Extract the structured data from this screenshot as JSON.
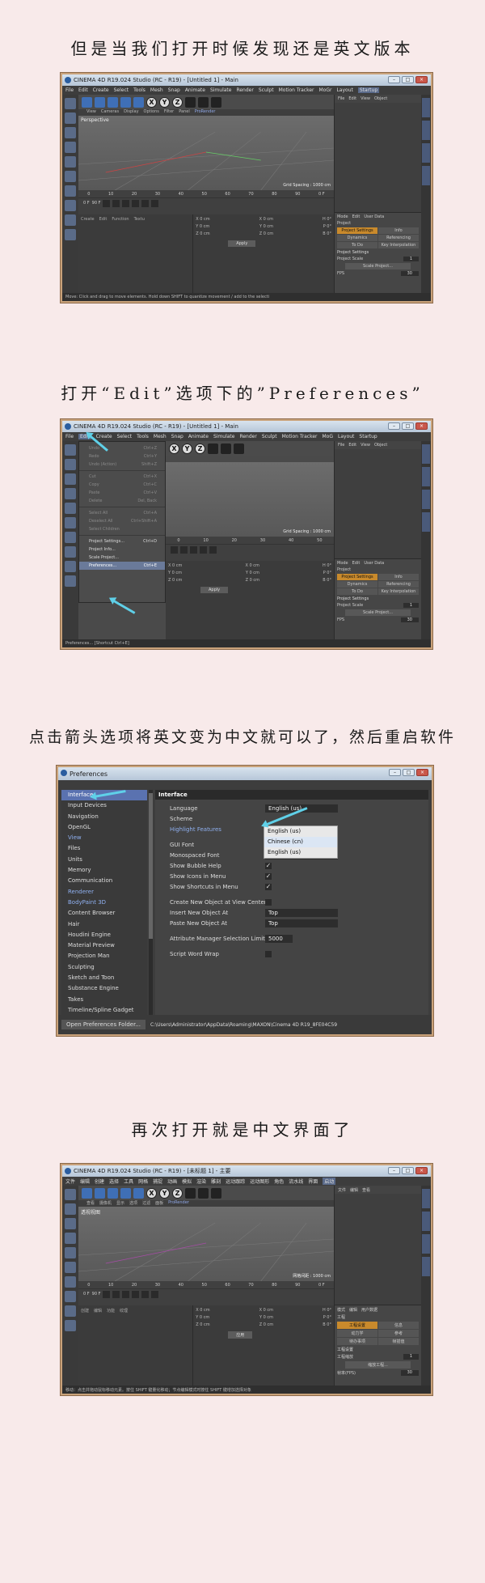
{
  "captions": {
    "c1": "但是当我们打开时候发现还是英文版本",
    "c2": "打开“Edit”选项下的”Preferences”",
    "c3": "点击箭头选项将英文变为中文就可以了，然后重启软件",
    "c4": "再次打开就是中文界面了"
  },
  "shot1": {
    "title": "CINEMA 4D R19.024 Studio (RC - R19) - [Untitled 1] - Main",
    "menu": [
      "File",
      "Edit",
      "Create",
      "Select",
      "Tools",
      "Mesh",
      "Snap",
      "Animate",
      "Simulate",
      "Render",
      "Sculpt",
      "Motion Tracker",
      "MoGr",
      "Layout",
      "Startup"
    ],
    "vptabs": [
      "View",
      "Cameras",
      "Display",
      "Options",
      "Filter",
      "Panel",
      "ProRender"
    ],
    "viewport_label": "Perspective",
    "grid_spacing": "Grid Spacing : 1000 cm",
    "ruler": [
      "0",
      "10",
      "20",
      "30",
      "40",
      "50",
      "60",
      "70",
      "80",
      "90",
      "0 F"
    ],
    "frame_start": "0 F",
    "frame_end": "90 F",
    "mat_menu": [
      "Create",
      "Edit",
      "Function",
      "Textu"
    ],
    "coords": [
      [
        "X 0 cm",
        "X 0 cm",
        "H 0°"
      ],
      [
        "Y 0 cm",
        "Y 0 cm",
        "P 0°"
      ],
      [
        "Z 0 cm",
        "Z 0 cm",
        "B 0°"
      ]
    ],
    "apply": "Apply",
    "om_menu": [
      "File",
      "Edit",
      "View",
      "Object"
    ],
    "attr_menu": [
      "Mode",
      "Edit",
      "User Data"
    ],
    "attr_obj": "Project",
    "tabs": [
      "Project Settings",
      "Info",
      "Dynamics",
      "Referencing",
      "To Do",
      "Key Interpolation"
    ],
    "section": "Project Settings",
    "field1_label": "Project Scale",
    "field1_val": "1",
    "scale_btn": "Scale Project...",
    "field2_label": "FPS",
    "field2_val": "30",
    "status": "Move: Click and drag to move elements. Hold down SHIFT to quantize movement / add to the selecti"
  },
  "shot2": {
    "title": "CINEMA 4D R19.024 Studio (RC - R19) - [Untitled 1] - Main",
    "menu": [
      "File",
      "Edit",
      "Create",
      "Select",
      "Tools",
      "Mesh",
      "Snap",
      "Animate",
      "Simulate",
      "Render",
      "Sculpt",
      "Motion Tracker",
      "MoG",
      "Layout",
      "Startup"
    ],
    "editmenu": [
      {
        "label": "Undo",
        "key": "Ctrl+Z"
      },
      {
        "label": "Redo",
        "key": "Ctrl+Y"
      },
      {
        "label": "Undo (Action)",
        "key": "Shift+Z"
      },
      {
        "label": "Cut",
        "key": "Ctrl+X"
      },
      {
        "label": "Copy",
        "key": "Ctrl+C"
      },
      {
        "label": "Paste",
        "key": "Ctrl+V"
      },
      {
        "label": "Delete",
        "key": "Del, Back"
      },
      {
        "label": "Select All",
        "key": "Ctrl+A"
      },
      {
        "label": "Deselect All",
        "key": "Ctrl+Shift+A"
      },
      {
        "label": "Select Children",
        "key": ""
      },
      {
        "label": "Project Settings...",
        "key": "Ctrl+D"
      },
      {
        "label": "Project Info...",
        "key": ""
      },
      {
        "label": "Scale Project...",
        "key": ""
      },
      {
        "label": "Preferences...",
        "key": "Ctrl+E"
      }
    ],
    "status": "Preferences... [Shortcut Ctrl+E]"
  },
  "prefs": {
    "title": "Preferences",
    "categories": [
      "Interface",
      "Input Devices",
      "Navigation",
      "OpenGL",
      "View",
      "Files",
      "Units",
      "Memory",
      "Communication",
      "Renderer",
      "BodyPaint 3D",
      "Content Browser",
      "Hair",
      "Houdini Engine",
      "Material Preview",
      "Projection Man",
      "Sculpting",
      "Sketch and Toon",
      "Substance Engine",
      "Takes",
      "Timeline/Spline Gadget",
      "Import/Export"
    ],
    "panel_head": "Interface",
    "rows": [
      {
        "label": "Language",
        "value": "English (us)"
      },
      {
        "label": "Scheme",
        "value": ""
      },
      {
        "label": "Highlight Features",
        "value": ""
      },
      {
        "label": "GUI Font",
        "value": "微软雅黑"
      },
      {
        "label": "Monospaced Font",
        "value": "Courier New"
      },
      {
        "label": "Show Bubble Help",
        "value": "✓"
      },
      {
        "label": "Show Icons in Menu",
        "value": "✓"
      },
      {
        "label": "Show Shortcuts in Menu",
        "value": "✓"
      },
      {
        "label": "Create New Object at View Center",
        "value": ""
      },
      {
        "label": "Insert New Object At",
        "value": "Top"
      },
      {
        "label": "Paste New Object At",
        "value": "Top"
      },
      {
        "label": "Attribute Manager Selection Limit",
        "value": "5000"
      },
      {
        "label": "Script Word Wrap",
        "value": ""
      }
    ],
    "lang_options": [
      "English (us)",
      "Chinese (cn)",
      "English (us)"
    ],
    "open_btn": "Open Preferences Folder...",
    "path": "C:\\Users\\Administrator\\AppData\\Roaming\\MAXON\\Cinema 4D R19_8FE04C59"
  },
  "shot4": {
    "title": "CINEMA 4D R19.024 Studio (RC - R19) - [未标题 1] - 主要",
    "menu": [
      "文件",
      "编辑",
      "创建",
      "选择",
      "工具",
      "网格",
      "捕捉",
      "动画",
      "模拟",
      "渲染",
      "雕刻",
      "运动跟踪",
      "运动图形",
      "角色",
      "流水线",
      "界面",
      "启动"
    ],
    "vptabs": [
      "查看",
      "摄像机",
      "显示",
      "选项",
      "过滤",
      "面板",
      "ProRender"
    ],
    "viewport_label": "透视视图",
    "grid_spacing": "网格间距 : 1000 cm",
    "ruler": [
      "0",
      "10",
      "20",
      "30",
      "40",
      "50",
      "60",
      "70",
      "80",
      "90",
      "0 F"
    ],
    "frame_start": "0 F",
    "frame_end": "90 F",
    "mat_menu": [
      "创建",
      "编辑",
      "功能",
      "纹理"
    ],
    "coords": [
      [
        "X 0 cm",
        "X 0 cm",
        "H 0°"
      ],
      [
        "Y 0 cm",
        "Y 0 cm",
        "P 0°"
      ],
      [
        "Z 0 cm",
        "Z 0 cm",
        "B 0°"
      ]
    ],
    "apply": "应用",
    "om_menu": [
      "文件",
      "编辑",
      "查看"
    ],
    "attr_menu": [
      "模式",
      "编辑",
      "用户数据"
    ],
    "attr_obj": "工程",
    "tabs": [
      "工程设置",
      "信息",
      "动力学",
      "参考",
      "待办事项",
      "帧插值"
    ],
    "section": "工程设置",
    "field1_label": "工程缩放",
    "field1_val": "1",
    "scale_btn": "缩放工程...",
    "field2_label": "帧率(FPS)",
    "field2_val": "30",
    "status": "移动：点击并拖动鼠标移动元素。按住 SHIFT 键量化移动；节点编辑模式时按住 SHIFT 键增加选择对象"
  }
}
